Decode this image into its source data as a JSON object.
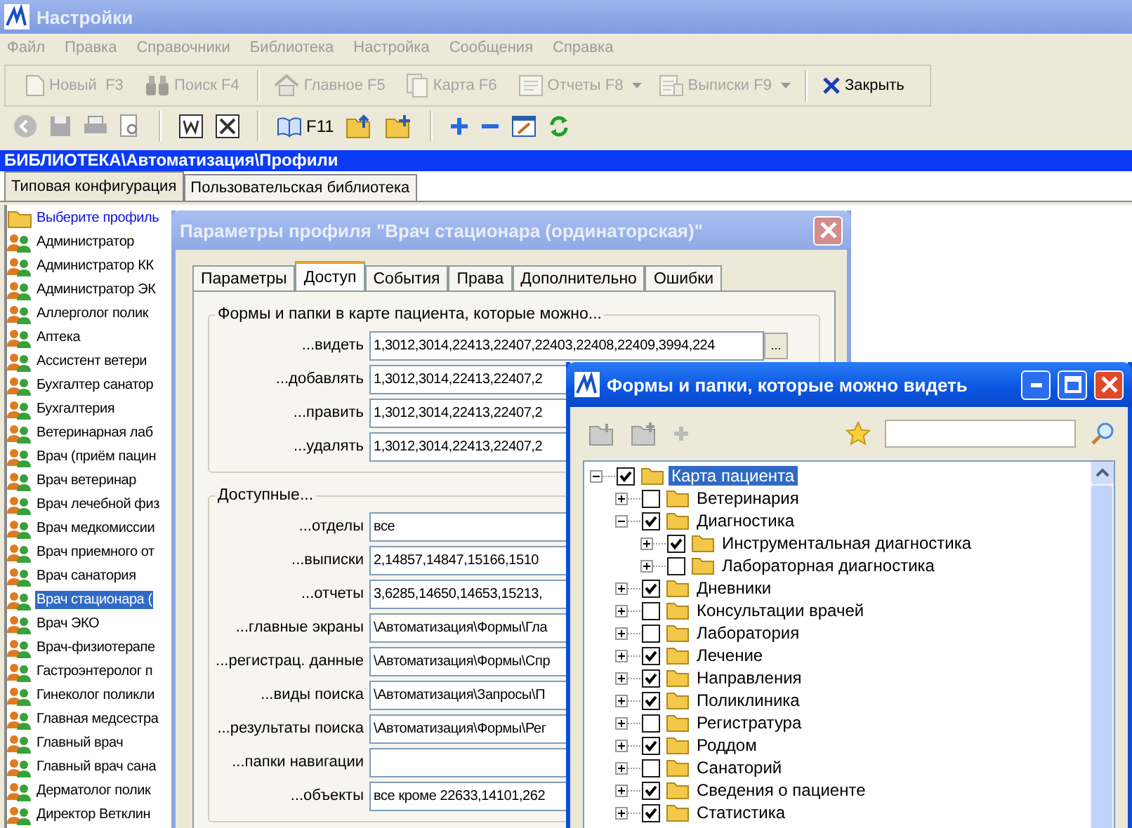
{
  "window": {
    "title": "Настройки"
  },
  "menu": [
    {
      "label": "Файл",
      "disabled": true
    },
    {
      "label": "Правка",
      "disabled": true
    },
    {
      "label": "Справочники",
      "disabled": true
    },
    {
      "label": "Библиотека",
      "disabled": true
    },
    {
      "label": "Настройка",
      "disabled": true
    },
    {
      "label": "Сообщения",
      "disabled": true
    },
    {
      "label": "Справка",
      "disabled": true
    }
  ],
  "toolbar": [
    {
      "label": "Новый  F3",
      "kind": "new",
      "disabled": true,
      "dropdown": false
    },
    {
      "label": "Поиск F4",
      "kind": "search",
      "disabled": true,
      "dropdown": false
    },
    {
      "label": "Главное F5",
      "kind": "home",
      "disabled": true,
      "dropdown": false
    },
    {
      "label": "Карта F6",
      "kind": "card",
      "disabled": true,
      "dropdown": false
    },
    {
      "label": "Отчеты F8",
      "kind": "reports",
      "disabled": true,
      "dropdown": true
    },
    {
      "label": "Выписки F9",
      "kind": "extracts",
      "disabled": true,
      "dropdown": true
    },
    {
      "label": "Закрыть",
      "kind": "close",
      "disabled": false,
      "dropdown": false
    }
  ],
  "toolbar2": {
    "f11_label": "F11"
  },
  "path": "БИБЛИОТЕКА\\Автоматизация\\Профили",
  "library_tabs": [
    {
      "label": "Типовая конфигурация",
      "selected": true
    },
    {
      "label": "Пользовательская библиотека",
      "selected": false
    }
  ],
  "profiles": [
    {
      "label": "Выберите профиль",
      "kind": "folder",
      "selected": false
    },
    {
      "label": "Администратор",
      "kind": "profile",
      "selected": false
    },
    {
      "label": "Администратор КК",
      "kind": "profile",
      "selected": false
    },
    {
      "label": "Администратор ЭК",
      "kind": "profile",
      "selected": false
    },
    {
      "label": "Аллерголог полик",
      "kind": "profile",
      "selected": false
    },
    {
      "label": "Аптека",
      "kind": "profile",
      "selected": false
    },
    {
      "label": "Ассистент ветери",
      "kind": "profile",
      "selected": false
    },
    {
      "label": "Бухгалтер санатор",
      "kind": "profile",
      "selected": false
    },
    {
      "label": "Бухгалтерия",
      "kind": "profile",
      "selected": false
    },
    {
      "label": "Ветеринарная лаб",
      "kind": "profile",
      "selected": false
    },
    {
      "label": "Врач (приём пацин",
      "kind": "profile",
      "selected": false
    },
    {
      "label": "Врач ветеринар",
      "kind": "profile",
      "selected": false
    },
    {
      "label": "Врач лечебной физ",
      "kind": "profile",
      "selected": false
    },
    {
      "label": "Врач медкомиссии",
      "kind": "profile",
      "selected": false
    },
    {
      "label": "Врач приемного от",
      "kind": "profile",
      "selected": false
    },
    {
      "label": "Врач санатория",
      "kind": "profile",
      "selected": false
    },
    {
      "label": "Врач стационара (",
      "kind": "profile",
      "selected": true
    },
    {
      "label": "Врач ЭКО",
      "kind": "profile",
      "selected": false
    },
    {
      "label": "Врач-физиотерапе",
      "kind": "profile",
      "selected": false
    },
    {
      "label": "Гастроэнтеролог п",
      "kind": "profile",
      "selected": false
    },
    {
      "label": "Гинеколог поликли",
      "kind": "profile",
      "selected": false
    },
    {
      "label": "Главная медсестра",
      "kind": "profile",
      "selected": false
    },
    {
      "label": "Главный врач",
      "kind": "profile",
      "selected": false
    },
    {
      "label": "Главный врач сана",
      "kind": "profile",
      "selected": false
    },
    {
      "label": "Дерматолог полик",
      "kind": "profile",
      "selected": false
    },
    {
      "label": "Директор Ветклин",
      "kind": "profile",
      "selected": false
    }
  ],
  "profile_dialog": {
    "title": "Параметры профиля \"Врач стационара (ординаторская)\"",
    "tabs": [
      {
        "label": "Параметры",
        "selected": false
      },
      {
        "label": "Доступ",
        "selected": true
      },
      {
        "label": "События",
        "selected": false
      },
      {
        "label": "Права",
        "selected": false
      },
      {
        "label": "Дополнительно",
        "selected": false
      },
      {
        "label": "Ошибки",
        "selected": false
      }
    ],
    "forms_group": {
      "legend": "Формы и папки в карте пациента, которые можно...",
      "rows": [
        {
          "label": "...видеть",
          "value": "1,3012,3014,22413,22407,22403,22408,22409,3994,224",
          "button": "..."
        },
        {
          "label": "...добавлять",
          "value": "1,3012,3014,22413,22407,2"
        },
        {
          "label": "...править",
          "value": "1,3012,3014,22413,22407,2"
        },
        {
          "label": "...удалять",
          "value": "1,3012,3014,22413,22407,2"
        }
      ]
    },
    "available_group": {
      "legend": "Доступные...",
      "rows": [
        {
          "label": "...отделы",
          "value": "все"
        },
        {
          "label": "...выписки",
          "value": "2,14857,14847,15166,1510"
        },
        {
          "label": "...отчеты",
          "value": "3,6285,14650,14653,15213,"
        },
        {
          "label": "...главные экраны",
          "value": "\\Автоматизация\\Формы\\Гла"
        },
        {
          "label": "...регистрац. данные",
          "value": "\\Автоматизация\\Формы\\Спр"
        },
        {
          "label": "...виды поиска",
          "value": "\\Автоматизация\\Запросы\\П"
        },
        {
          "label": "...результаты поиска",
          "value": "\\Автоматизация\\Формы\\Рег"
        },
        {
          "label": "...папки навигации"
        },
        {
          "label": "...объекты",
          "value": "все кроме 22633,14101,262"
        }
      ]
    }
  },
  "tree_dialog": {
    "title": "Формы и папки, которые можно видеть",
    "tree": [
      {
        "label": "Карта пациента",
        "checked": true,
        "expanded": true,
        "selected": true,
        "children": [
          {
            "label": "Ветеринария",
            "checked": false,
            "expanded": false,
            "selected": false
          },
          {
            "label": "Диагностика",
            "checked": true,
            "expanded": true,
            "selected": false,
            "children": [
              {
                "label": "Инструментальная диагностика",
                "checked": true,
                "expanded": false,
                "selected": false
              },
              {
                "label": "Лабораторная диагностика",
                "checked": false,
                "expanded": false,
                "selected": false
              }
            ]
          },
          {
            "label": "Дневники",
            "checked": true,
            "expanded": false,
            "selected": false
          },
          {
            "label": "Консультации врачей",
            "checked": false,
            "expanded": false,
            "selected": false
          },
          {
            "label": "Лаборатория",
            "checked": false,
            "expanded": false,
            "selected": false
          },
          {
            "label": "Лечение",
            "checked": true,
            "expanded": false,
            "selected": false
          },
          {
            "label": "Направления",
            "checked": true,
            "expanded": false,
            "selected": false
          },
          {
            "label": "Поликлиника",
            "checked": true,
            "expanded": false,
            "selected": false
          },
          {
            "label": "Регистратура",
            "checked": false,
            "expanded": false,
            "selected": false
          },
          {
            "label": "Роддом",
            "checked": true,
            "expanded": false,
            "selected": false
          },
          {
            "label": "Санаторий",
            "checked": false,
            "expanded": false,
            "selected": false
          },
          {
            "label": "Сведения о пациенте",
            "checked": true,
            "expanded": false,
            "selected": false
          },
          {
            "label": "Статистика",
            "checked": true,
            "expanded": false,
            "selected": false
          }
        ]
      }
    ]
  }
}
